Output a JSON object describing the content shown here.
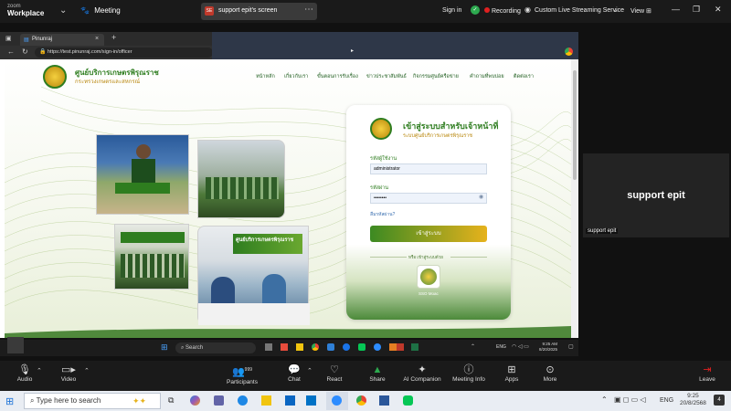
{
  "zoom": {
    "logo_top": "zoom",
    "logo_bottom": "Workplace",
    "meeting_label": "Meeting",
    "share_tab": "support epit's screen",
    "sign_in": "Sign in",
    "recording": "Recording",
    "streaming": "Custom Live Streaming Service",
    "view": "View"
  },
  "browser": {
    "tab_title": "Pinunraj",
    "url": "https://test.pinunraj.com/sign-in/officer"
  },
  "site": {
    "org_name": "ศูนย์บริการเกษตรพิรุณราช",
    "org_sub": "กระทรวงเกษตรและสหกรณ์",
    "nav": [
      "หน้าหลัก",
      "เกี่ยวกับเรา",
      "ขั้นตอนการรับเรื่อง",
      "ข่าวประชาสัมพันธ์",
      "กิจกรรมศูนย์ครือข่าย",
      "คำถามที่พบบ่อย",
      "ติดต่อเรา"
    ]
  },
  "login": {
    "title": "เข้าสู่ระบบสำหรับเจ้าหน้าที่",
    "subtitle": "ระบบศูนย์บริการเกษตรพิรุณราช",
    "username_label": "รหัสผู้ใช้งาน",
    "username_value": "administrator",
    "password_label": "รหัสผ่าน",
    "password_value": "••••••••",
    "forgot": "ลืมรหัสผ่าน?",
    "submit": "เข้าสู่ระบบ",
    "or_text": "หรือ เข้าสู่ระบบด้วย",
    "sso": "SSO Moac"
  },
  "banner": {
    "text": "ศูนย์บริการเกษตรพิรุณราช"
  },
  "remote_taskbar": {
    "search": "Search",
    "lang": "ENG",
    "time": "9:25 AM",
    "date": "8/20/2025"
  },
  "participant": {
    "name": "support epit",
    "label": "support epit"
  },
  "controls": {
    "audio": "Audio",
    "video": "Video",
    "participants": "Participants",
    "participants_count": "999",
    "chat": "Chat",
    "react": "React",
    "share": "Share",
    "ai": "AI Companion",
    "info": "Meeting Info",
    "apps": "Apps",
    "more": "More",
    "leave": "Leave"
  },
  "win_taskbar": {
    "search_placeholder": "Type here to search",
    "lang": "ENG",
    "time": "9:25",
    "date": "20/8/2568",
    "notif": "4"
  },
  "colors": {
    "green": "#2e7d1f",
    "gold": "#e6b21c",
    "zoom_green": "#2da94f"
  }
}
